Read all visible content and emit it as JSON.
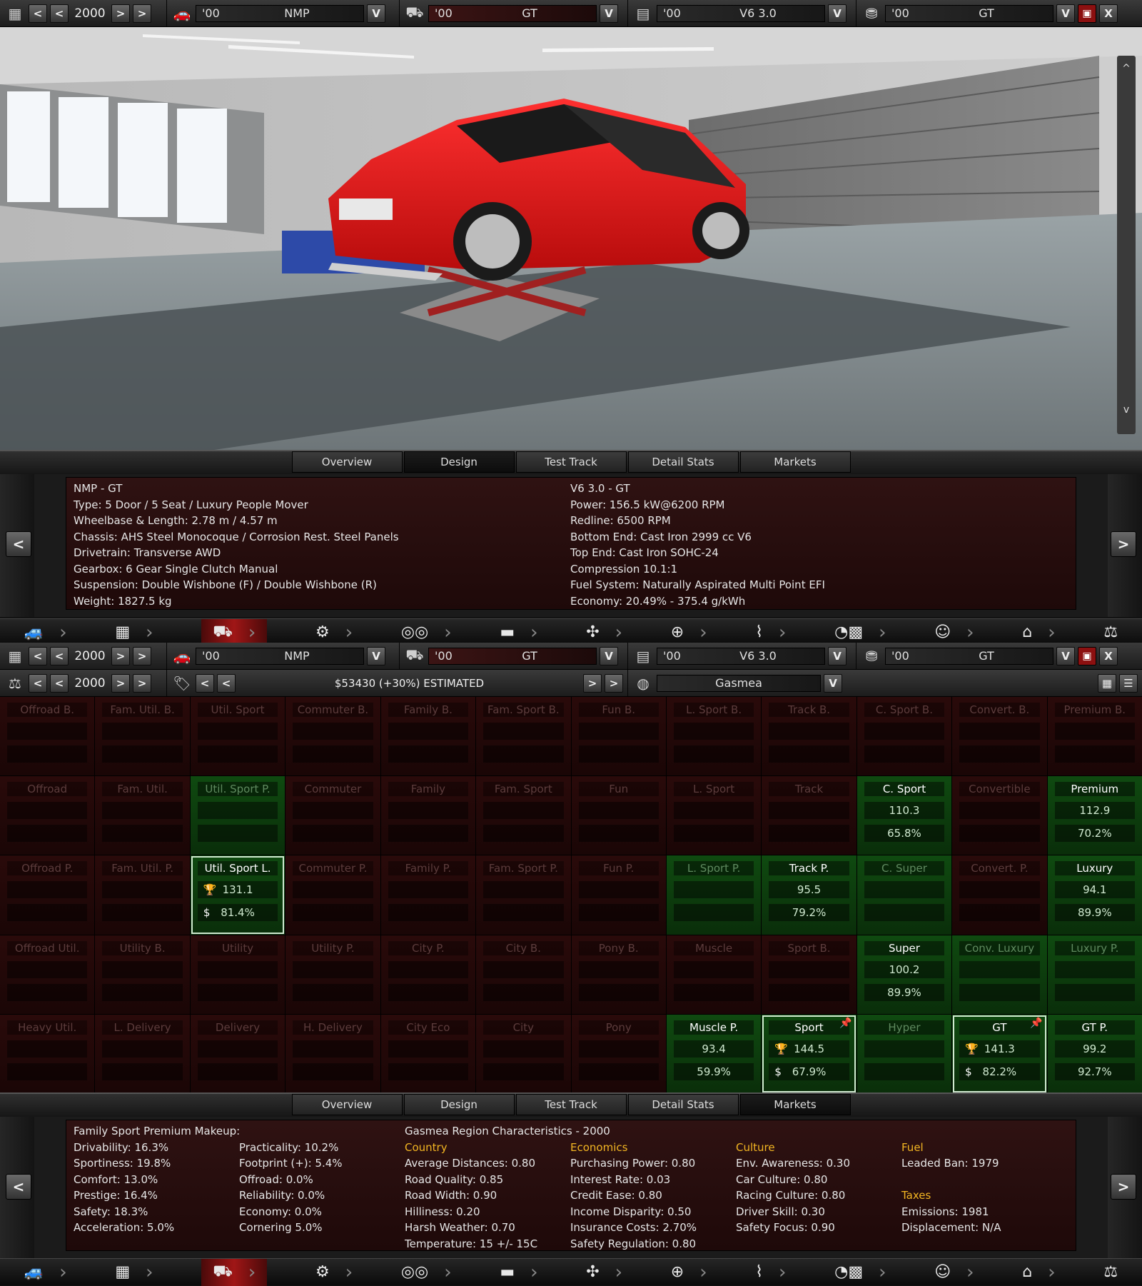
{
  "selector": {
    "year": "2000",
    "model_year": "'00",
    "model_name": "NMP",
    "trim_year": "'00",
    "trim_name": "GT",
    "engine_year": "'00",
    "engine_name": "V6 3.0",
    "engine_variant_year": "'00",
    "engine_variant_name": "GT",
    "prev": "<",
    "next": ">",
    "dropdown": "V",
    "close": "X"
  },
  "market_bar": {
    "year": "2000",
    "price": "$53430 (+30%) ESTIMATED",
    "region": "Gasmea",
    "prev": "<",
    "next": ">",
    "dropdown": "V"
  },
  "tabs": [
    "Overview",
    "Design",
    "Test Track",
    "Detail Stats",
    "Markets"
  ],
  "design": {
    "left": [
      "NMP - GT",
      "Type: 5 Door / 5 Seat / Luxury People Mover",
      "Wheelbase & Length: 2.78 m / 4.57 m",
      "Chassis: AHS Steel Monocoque / Corrosion Rest. Steel Panels",
      "Drivetrain: Transverse AWD",
      "Gearbox: 6 Gear Single Clutch Manual",
      "Suspension: Double Wishbone (F) / Double Wishbone (R)",
      "Weight: 1827.5 kg"
    ],
    "right": [
      "V6 3.0 - GT",
      "Power: 156.5 kW@6200 RPM",
      "Redline: 6500 RPM",
      "Bottom End: Cast Iron 2999 cc V6",
      "Top End: Cast Iron SOHC-24",
      "Compression 10.1:1",
      "Fuel System: Naturally Aspirated Multi Point EFI",
      "Economy: 20.49% - 375.4 g/kWh"
    ]
  },
  "grid": [
    [
      "Offroad B.",
      "Fam. Util. B.",
      "Util. Sport",
      "Commuter B.",
      "Family B.",
      "Fam. Sport B.",
      "Fun B.",
      "L. Sport B.",
      "Track B.",
      "C. Sport B.",
      "Convert. B.",
      "Premium B."
    ],
    [
      "Offroad",
      "Fam. Util.",
      "Util. Sport P.",
      "Commuter",
      "Family",
      "Fam. Sport",
      "Fun",
      "L. Sport",
      "Track",
      "C. Sport",
      "Convertible",
      "Premium"
    ],
    [
      "Offroad P.",
      "Fam. Util. P.",
      "Util. Sport L.",
      "Commuter P.",
      "Family P.",
      "Fam. Sport P.",
      "Fun P.",
      "L. Sport P.",
      "Track P.",
      "C. Super",
      "Convert. P.",
      "Luxury"
    ],
    [
      "Offroad Util.",
      "Utility B.",
      "Utility",
      "Utility P.",
      "City P.",
      "City B.",
      "Pony B.",
      "Muscle",
      "Sport B.",
      "Super",
      "Conv. Luxury",
      "Luxury P."
    ],
    [
      "Heavy Util.",
      "L. Delivery",
      "Delivery",
      "H. Delivery",
      "City Eco",
      "City",
      "Pony",
      "Muscle P.",
      "Sport",
      "Hyper",
      "GT",
      "GT P."
    ]
  ],
  "grid_values": {
    "1-2": {
      "green": true,
      "dim": true
    },
    "1-9": {
      "green": true,
      "v1": "110.3",
      "v2": "65.8%"
    },
    "1-11": {
      "green": true,
      "v1": "112.9",
      "v2": "70.2%"
    },
    "2-2": {
      "green": true,
      "sel": true,
      "v1": "131.1",
      "v2": "81.4%",
      "icons": true
    },
    "2-7": {
      "green": true,
      "dim": true
    },
    "2-8": {
      "green": true,
      "v1": "95.5",
      "v2": "79.2%"
    },
    "2-9": {
      "green": true,
      "dim": true
    },
    "2-11": {
      "green": true,
      "v1": "94.1",
      "v2": "89.9%"
    },
    "3-9": {
      "green": true,
      "v1": "100.2",
      "v2": "89.9%"
    },
    "3-10": {
      "green": true,
      "dim": true
    },
    "3-11": {
      "green": true,
      "dim": true
    },
    "4-7": {
      "green": true,
      "v1": "93.4",
      "v2": "59.9%"
    },
    "4-8": {
      "green": true,
      "sel": true,
      "pin": true,
      "v1": "144.5",
      "v2": "67.9%",
      "icons": true
    },
    "4-9": {
      "green": true,
      "dim": true
    },
    "4-10": {
      "green": true,
      "sel": true,
      "pin": true,
      "v1": "141.3",
      "v2": "82.2%",
      "icons": true
    },
    "4-11": {
      "green": true,
      "v1": "99.2",
      "v2": "92.7%"
    }
  },
  "markets": {
    "makeup_title": "Family Sport Premium Makeup:",
    "makeup_a": [
      "Drivability: 16.3%",
      "Sportiness: 19.8%",
      "Comfort: 13.0%",
      "Prestige: 16.4%",
      "Safety: 18.3%",
      "Acceleration: 5.0%"
    ],
    "makeup_b": [
      "Practicality: 10.2%",
      "Footprint (+): 5.4%",
      "Offroad: 0.0%",
      "Reliability: 0.0%",
      "Economy: 0.0%",
      "Cornering 5.0%"
    ],
    "region_title": "Gasmea Region Characteristics - 2000",
    "country_h": "Country",
    "country": [
      "Average Distances: 0.80",
      "Road Quality: 0.85",
      "Road Width: 0.90",
      "Hilliness: 0.20",
      "Harsh Weather: 0.70",
      "Temperature: 15 +/- 15C"
    ],
    "economics_h": "Economics",
    "economics": [
      "Purchasing Power: 0.80",
      "Interest Rate: 0.03",
      "Credit Ease: 0.80",
      "Income Disparity: 0.50",
      "Insurance Costs: 2.70%",
      "Safety Regulation: 0.80"
    ],
    "culture_h": "Culture",
    "culture": [
      "Env. Awareness: 0.30",
      "Car Culture: 0.80",
      "Racing Culture: 0.80",
      "Driver Skill: 0.30",
      "Safety Focus: 0.90"
    ],
    "fuel_h": "Fuel",
    "fuel": [
      "Leaded Ban: 1979"
    ],
    "taxes_h": "Taxes",
    "taxes": [
      "Emissions: 1981",
      "Displacement: N/A"
    ]
  },
  "colors": {
    "accent_gold": "#f2b522",
    "market_green": "#0f4a10",
    "market_red": "#2a0a0a",
    "car_red": "#e01a1a"
  }
}
